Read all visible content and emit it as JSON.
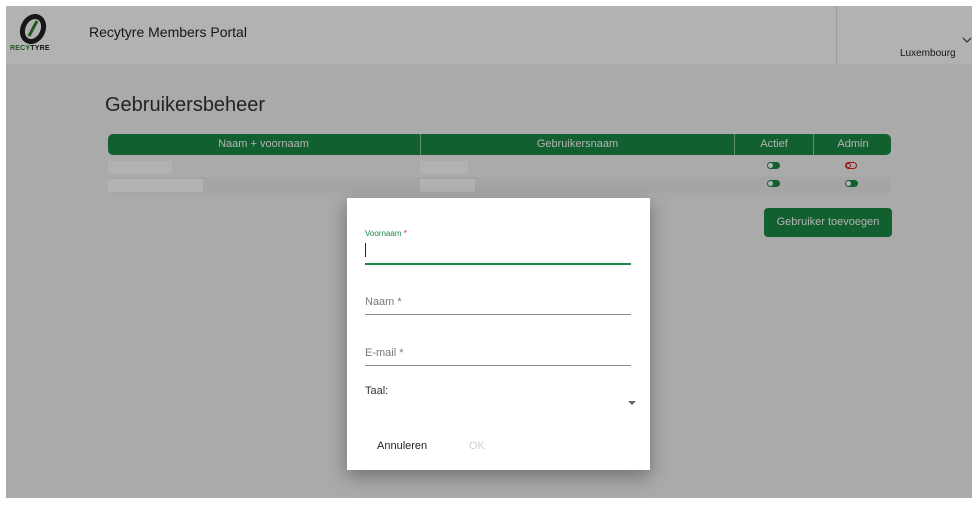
{
  "header": {
    "logo_text_green": "RECY",
    "logo_text_dark": "TYRE",
    "app_title": "Recytyre Members Portal",
    "country": "Luxembourg"
  },
  "page": {
    "title": "Gebruikersbeheer"
  },
  "table": {
    "columns": [
      "Naam + voornaam",
      "Gebruikersnaam",
      "Actief",
      "Admin"
    ],
    "rows": [
      {
        "naam": "",
        "gebruikersnaam": "",
        "actief": true,
        "admin": false
      },
      {
        "naam": "",
        "gebruikersnaam": "",
        "actief": true,
        "admin": true
      }
    ]
  },
  "add_user_label": "Gebruiker toevoegen",
  "dialog": {
    "fields": [
      {
        "label": "Voornaam",
        "required_mark": "*",
        "value": ""
      },
      {
        "label": "Naam",
        "required_mark": "*",
        "value": ""
      },
      {
        "label": "E-mail",
        "required_mark": "*",
        "value": ""
      }
    ],
    "language_label": "Taal:",
    "language_value": "",
    "cancel_label": "Annuleren",
    "ok_label": "OK"
  },
  "colors": {
    "accent": "#1a8a45",
    "toggle_off": "#dd2222",
    "overlay": "rgba(0,0,0,0.30)"
  }
}
